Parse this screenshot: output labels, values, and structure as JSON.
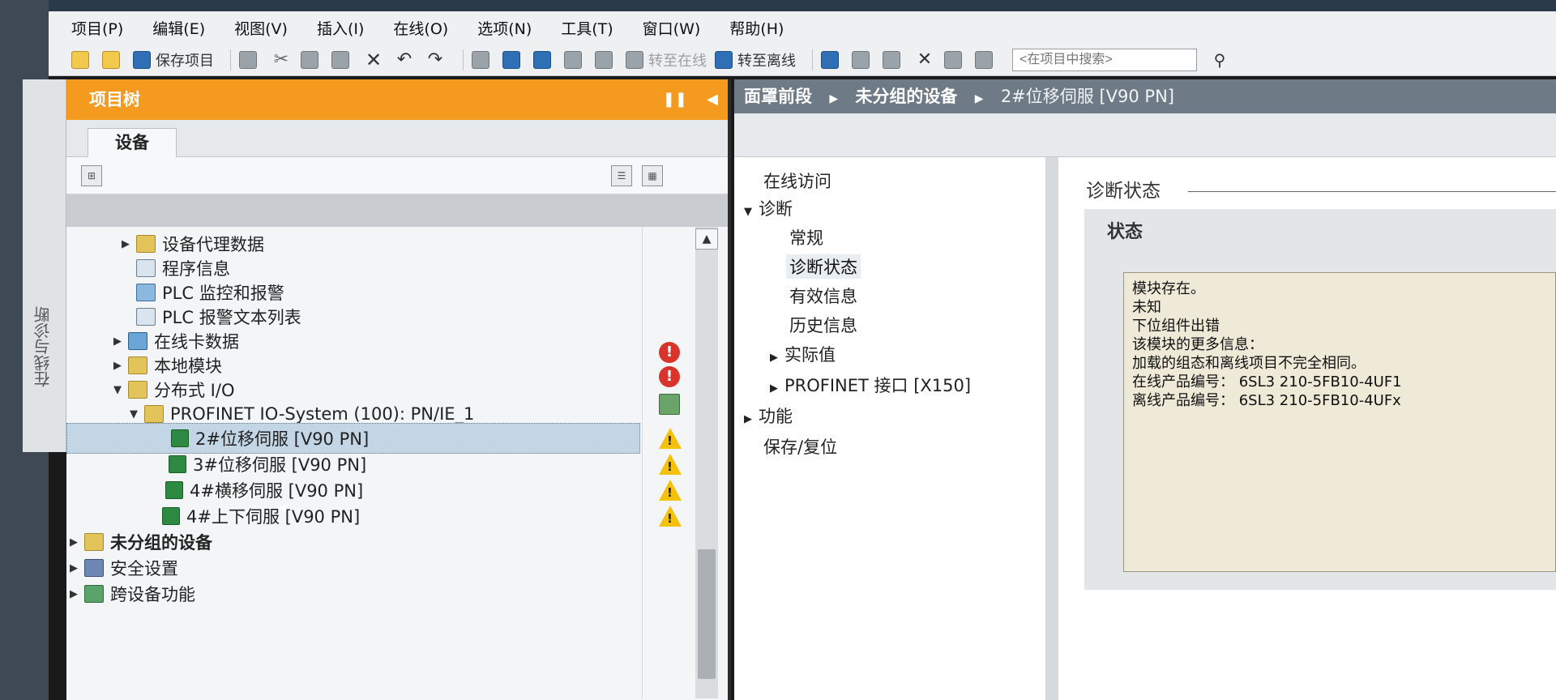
{
  "menubar": {
    "items": [
      "项目(P)",
      "编辑(E)",
      "视图(V)",
      "插入(I)",
      "在线(O)",
      "选项(N)",
      "工具(T)",
      "窗口(W)",
      "帮助(H)"
    ]
  },
  "toolbar": {
    "save_label": "保存项目",
    "go_online_label": "转至在线",
    "go_offline_label": "转至离线",
    "search_placeholder": "<在项目中搜索>"
  },
  "sidebar": {
    "vertical_tab_label": "在线与诊断"
  },
  "project_tree": {
    "title": "项目树",
    "tab_label": "设备",
    "items": [
      {
        "label": "设备代理数据",
        "level": 1,
        "arrow": "▶"
      },
      {
        "label": "程序信息",
        "level": 1,
        "arrow": ""
      },
      {
        "label": "PLC 监控和报警",
        "level": 1,
        "arrow": ""
      },
      {
        "label": "PLC 报警文本列表",
        "level": 1,
        "arrow": ""
      },
      {
        "label": "在线卡数据",
        "level": 1,
        "arrow": "▶"
      },
      {
        "label": "本地模块",
        "level": 1,
        "arrow": "▶"
      },
      {
        "label": "分布式 I/O",
        "level": 1,
        "arrow": "▼"
      },
      {
        "label": "PROFINET IO-System (100): PN/IE_1",
        "level": 2,
        "arrow": "▼"
      },
      {
        "label": "2#位移伺服 [V90 PN]",
        "level": 3,
        "arrow": ""
      },
      {
        "label": "3#位移伺服 [V90 PN]",
        "level": 3,
        "arrow": ""
      },
      {
        "label": "4#横移伺服 [V90 PN]",
        "level": 3,
        "arrow": ""
      },
      {
        "label": "4#上下伺服 [V90 PN]",
        "level": 3,
        "arrow": ""
      },
      {
        "label": "未分组的设备",
        "level": 0,
        "arrow": "▶"
      },
      {
        "label": "安全设置",
        "level": 0,
        "arrow": "▶"
      },
      {
        "label": "跨设备功能",
        "level": 0,
        "arrow": "▶"
      }
    ]
  },
  "editor": {
    "breadcrumb": [
      "面罩前段",
      "未分组的设备",
      "2#位移伺服 [V90 PN]"
    ],
    "nav": [
      {
        "label": "在线访问",
        "indent": 0,
        "arrow": ""
      },
      {
        "label": "诊断",
        "indent": 0,
        "arrow": "▼"
      },
      {
        "label": "常规",
        "indent": 1,
        "arrow": ""
      },
      {
        "label": "诊断状态",
        "indent": 1,
        "arrow": ""
      },
      {
        "label": "有效信息",
        "indent": 1,
        "arrow": ""
      },
      {
        "label": "历史信息",
        "indent": 1,
        "arrow": ""
      },
      {
        "label": "实际值",
        "indent": 1,
        "arrow": "▶"
      },
      {
        "label": "PROFINET 接口 [X150]",
        "indent": 1,
        "arrow": "▶"
      },
      {
        "label": "功能",
        "indent": 0,
        "arrow": "▶"
      },
      {
        "label": "保存/复位",
        "indent": 0,
        "arrow": ""
      }
    ],
    "section_title": "诊断状态",
    "status_heading": "状态",
    "status_lines": [
      "模块存在。",
      "未知",
      "下位组件出错",
      "",
      "该模块的更多信息：",
      "加载的组态和离线项目不完全相同。",
      "在线产品编号：  6SL3 210-5FB10-4UF1",
      "离线产品编号：  6SL3 210-5FB10-4UFx"
    ]
  },
  "colors": {
    "project_tree_header": "#f39a1f",
    "selection": "#c3d6e6",
    "warning": "#f4c20d",
    "error": "#d9342b",
    "status_text_bg": "#efe9d8"
  }
}
